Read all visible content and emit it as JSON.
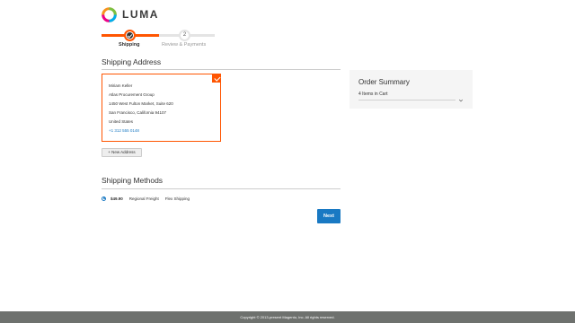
{
  "header": {
    "brand": "LUMA",
    "logo_icon": "luma-logo-icon"
  },
  "progress": {
    "steps": [
      {
        "label": "Shipping",
        "state": "complete",
        "icon": "check-icon"
      },
      {
        "label": "Review & Payments",
        "number": "2",
        "state": "pending"
      }
    ],
    "accent_color": "#ff5501"
  },
  "shipping_address": {
    "title": "Shipping Address",
    "selected_address": {
      "name": "Miriam Keller",
      "company": "Atlas Procurement Group",
      "street": "1450 West Fulton Market, Suite 620",
      "city_line": "San Francisco, California 94107",
      "country": "United States",
      "phone": "+1 312 555 0148",
      "selected_icon": "check-icon"
    },
    "new_address_label": "+ New Address"
  },
  "shipping_methods": {
    "title": "Shipping Methods",
    "options": [
      {
        "price": "$49.90",
        "method": "Regional Freight",
        "carrier": "Flex Shipping",
        "selected": true
      }
    ],
    "next_label": "Next",
    "button_color": "#1979c3"
  },
  "order_summary": {
    "title": "Order Summary",
    "items_label": "4 Items in Cart",
    "toggle_icon": "chevron-down-icon"
  },
  "footer": {
    "copyright": "Copyright © 2013-present Magento, Inc. All rights reserved."
  }
}
